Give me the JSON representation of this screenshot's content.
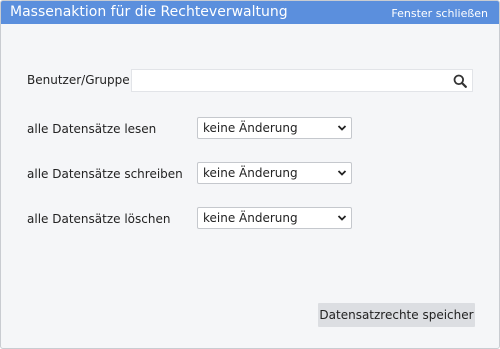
{
  "window": {
    "title": "Massenaktion für die Rechteverwaltung",
    "close_label": "Fenster schließen",
    "accent": "#5b8fdd"
  },
  "form": {
    "user_group": {
      "label": "Benutzer/Gruppe",
      "value": "",
      "icon": "search-icon"
    },
    "read": {
      "label": "alle Datensätze lesen",
      "selected": "keine Änderung"
    },
    "write": {
      "label": "alle Datensätze schreiben",
      "selected": "keine Änderung"
    },
    "delete": {
      "label": "alle Datensätze löschen",
      "selected": "keine Änderung"
    }
  },
  "footer": {
    "save_label": "Datensatzrechte speicher"
  }
}
